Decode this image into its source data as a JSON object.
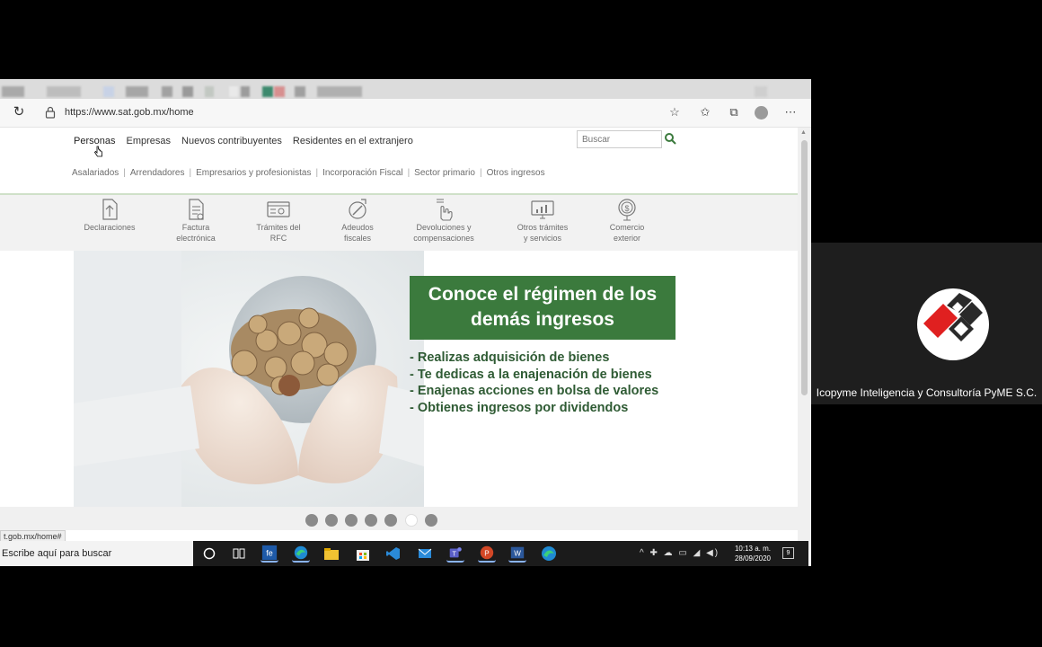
{
  "browser": {
    "url": "https://www.sat.gob.mx/home",
    "status_url": "t.gob.mx/home#"
  },
  "nav": {
    "primary": [
      "Personas",
      "Empresas",
      "Nuevos contribuyentes",
      "Residentes en el extranjero"
    ],
    "active_primary": "Personas",
    "secondary": [
      "Asalariados",
      "Arrendadores",
      "Empresarios y profesionistas",
      "Incorporación Fiscal",
      "Sector primario",
      "Otros ingresos"
    ],
    "search_placeholder": "Buscar"
  },
  "services": [
    {
      "line1": "Declaraciones",
      "line2": "",
      "icon": "declaraciones-icon"
    },
    {
      "line1": "Factura",
      "line2": "electrónica",
      "icon": "factura-icon"
    },
    {
      "line1": "Trámites del",
      "line2": "RFC",
      "icon": "rfc-icon"
    },
    {
      "line1": "Adeudos",
      "line2": "fiscales",
      "icon": "adeudos-icon"
    },
    {
      "line1": "Devoluciones y",
      "line2": "compensaciones",
      "icon": "devoluciones-icon"
    },
    {
      "line1": "Otros trámites",
      "line2": "y servicios",
      "icon": "otros-tramites-icon"
    },
    {
      "line1": "Comercio",
      "line2": "exterior",
      "icon": "comercio-exterior-icon"
    }
  ],
  "banner": {
    "title_line1": "Conoce el régimen de los",
    "title_line2": "demás ingresos",
    "items": [
      "- Realizas adquisición de bienes",
      "- Te dedicas a la enajenación de bienes",
      "- Enajenas acciones en bolsa de valores",
      "- Obtienes ingresos por dividendos"
    ],
    "title_color": "#3b7a3d",
    "text_color": "#2f5b34"
  },
  "carousel": {
    "count": 7,
    "active_index": 5
  },
  "taskbar": {
    "search_text": "Escribe aquí para buscar",
    "time": "10:13 a. m.",
    "date": "28/09/2020",
    "notifications": "9"
  },
  "participant": {
    "name": "Icopyme Inteligencia y Consultoría PyME S.C."
  }
}
